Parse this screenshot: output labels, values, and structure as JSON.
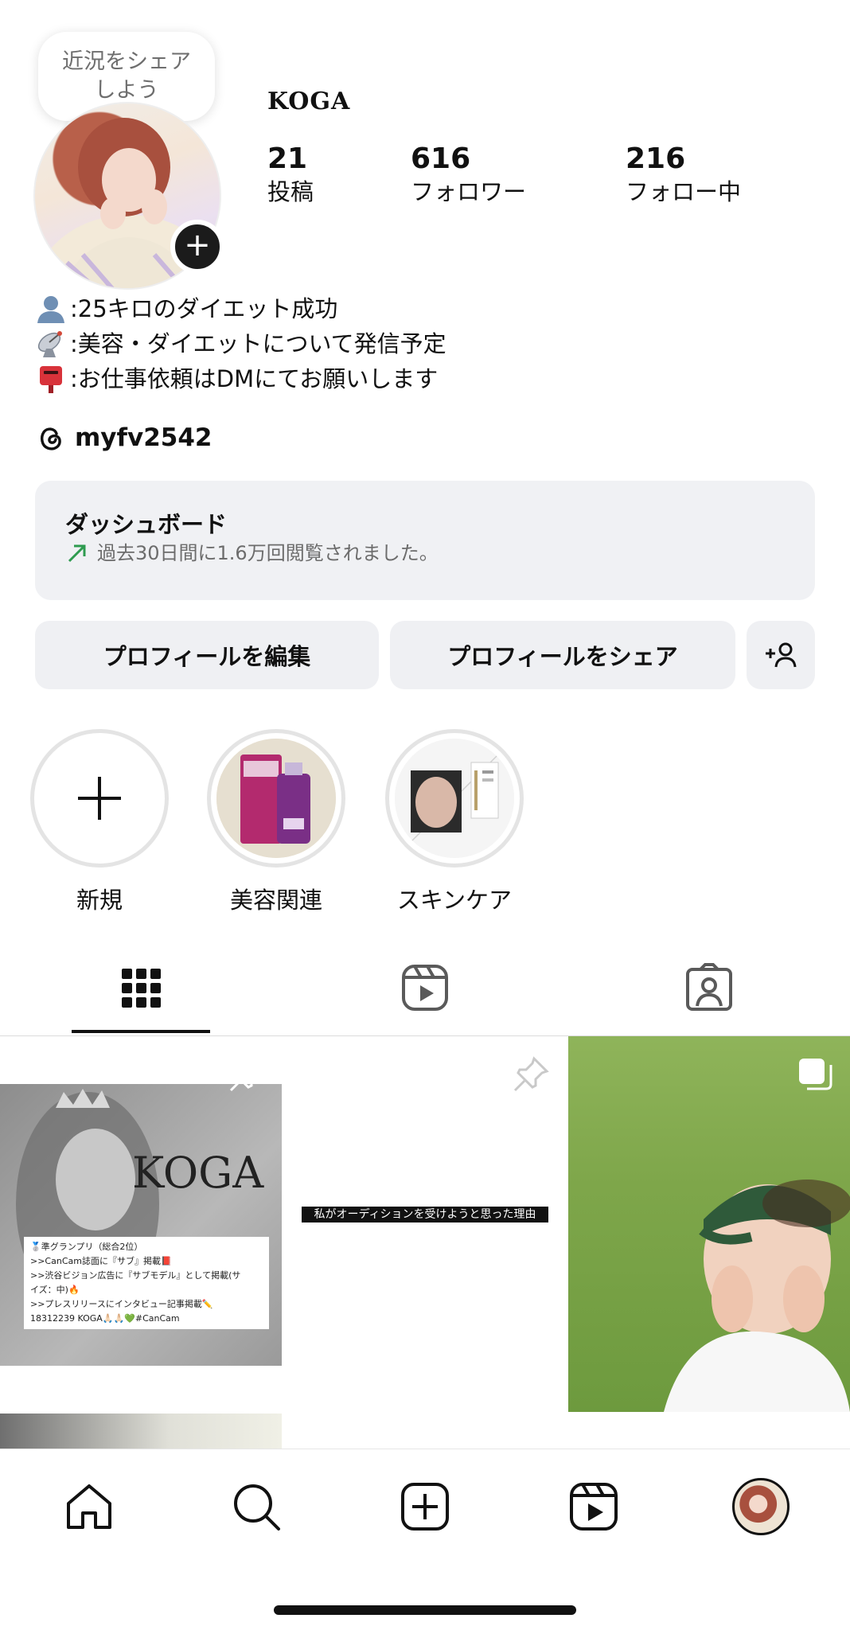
{
  "note": {
    "text_line1": "近況をシェア",
    "text_line2": "しよう"
  },
  "profile": {
    "username": "KOGA",
    "stats": [
      {
        "value": "21",
        "label": "投稿"
      },
      {
        "value": "616",
        "label": "フォロワー"
      },
      {
        "value": "216",
        "label": "フォロー中"
      }
    ],
    "bio": [
      {
        "icon": "bust-silhouette-icon",
        "text": ":25キロのダイエット成功"
      },
      {
        "icon": "satellite-antenna-icon",
        "text": ":美容・ダイエットについて発信予定"
      },
      {
        "icon": "postbox-icon",
        "text": ":お仕事依頼はDMにてお願いします"
      }
    ],
    "threads_handle": "myfv2542"
  },
  "dashboard": {
    "title": "ダッシュボード",
    "subtitle": "過去30日間に1.6万回閲覧されました。",
    "accent_color": "#2e9b4f"
  },
  "actions": {
    "edit_profile": "プロフィールを編集",
    "share_profile": "プロフィールをシェア"
  },
  "highlights": [
    {
      "label": "新規"
    },
    {
      "label": "美容関連"
    },
    {
      "label": "スキンケア"
    }
  ],
  "posts": {
    "post1": {
      "brand": "KOGA",
      "lines": [
        "🥈準グランプリ（総合2位）",
        ">>CanCam誌面に『サブ』掲載📕",
        ">>渋谷ビジョン広告に『サブモデル』として掲載(サ",
        "イズ：中)🔥",
        ">>プレスリリースにインタビュー記事掲載✏️",
        "18312239 KOGA🙏🏻🙏🏻💚#CanCam"
      ]
    },
    "post2": {
      "caption": "私がオーディションを受けようと思った理由"
    }
  },
  "colors": {
    "button_bg": "#eff0f3",
    "dashboard_bg": "#f0f1f4",
    "text": "#111111"
  }
}
